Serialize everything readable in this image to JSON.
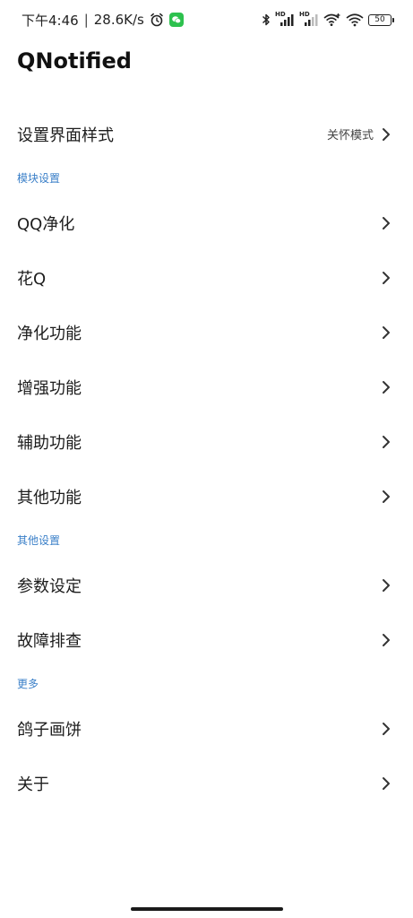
{
  "status_bar": {
    "time": "下午4:46",
    "separator": "|",
    "net_speed": "28.6K/s",
    "signal_hd_1": "HD",
    "signal_hd_2": "HD",
    "battery": "50"
  },
  "app": {
    "title": "QNotified"
  },
  "settings": {
    "ui_style": {
      "label": "设置界面样式",
      "value": "关怀模式"
    },
    "section_module": "模块设置",
    "module_items": [
      {
        "label": "QQ净化"
      },
      {
        "label": "花Q"
      },
      {
        "label": "净化功能"
      },
      {
        "label": "增强功能"
      },
      {
        "label": "辅助功能"
      },
      {
        "label": "其他功能"
      }
    ],
    "section_other": "其他设置",
    "other_items": [
      {
        "label": "参数设定"
      },
      {
        "label": "故障排查"
      }
    ],
    "section_more": "更多",
    "more_items": [
      {
        "label": "鸽子画饼"
      },
      {
        "label": "关于"
      }
    ]
  },
  "colors": {
    "section_header": "#3a7fc8",
    "wechat": "#2dc14e",
    "text": "#1d1d1d"
  }
}
